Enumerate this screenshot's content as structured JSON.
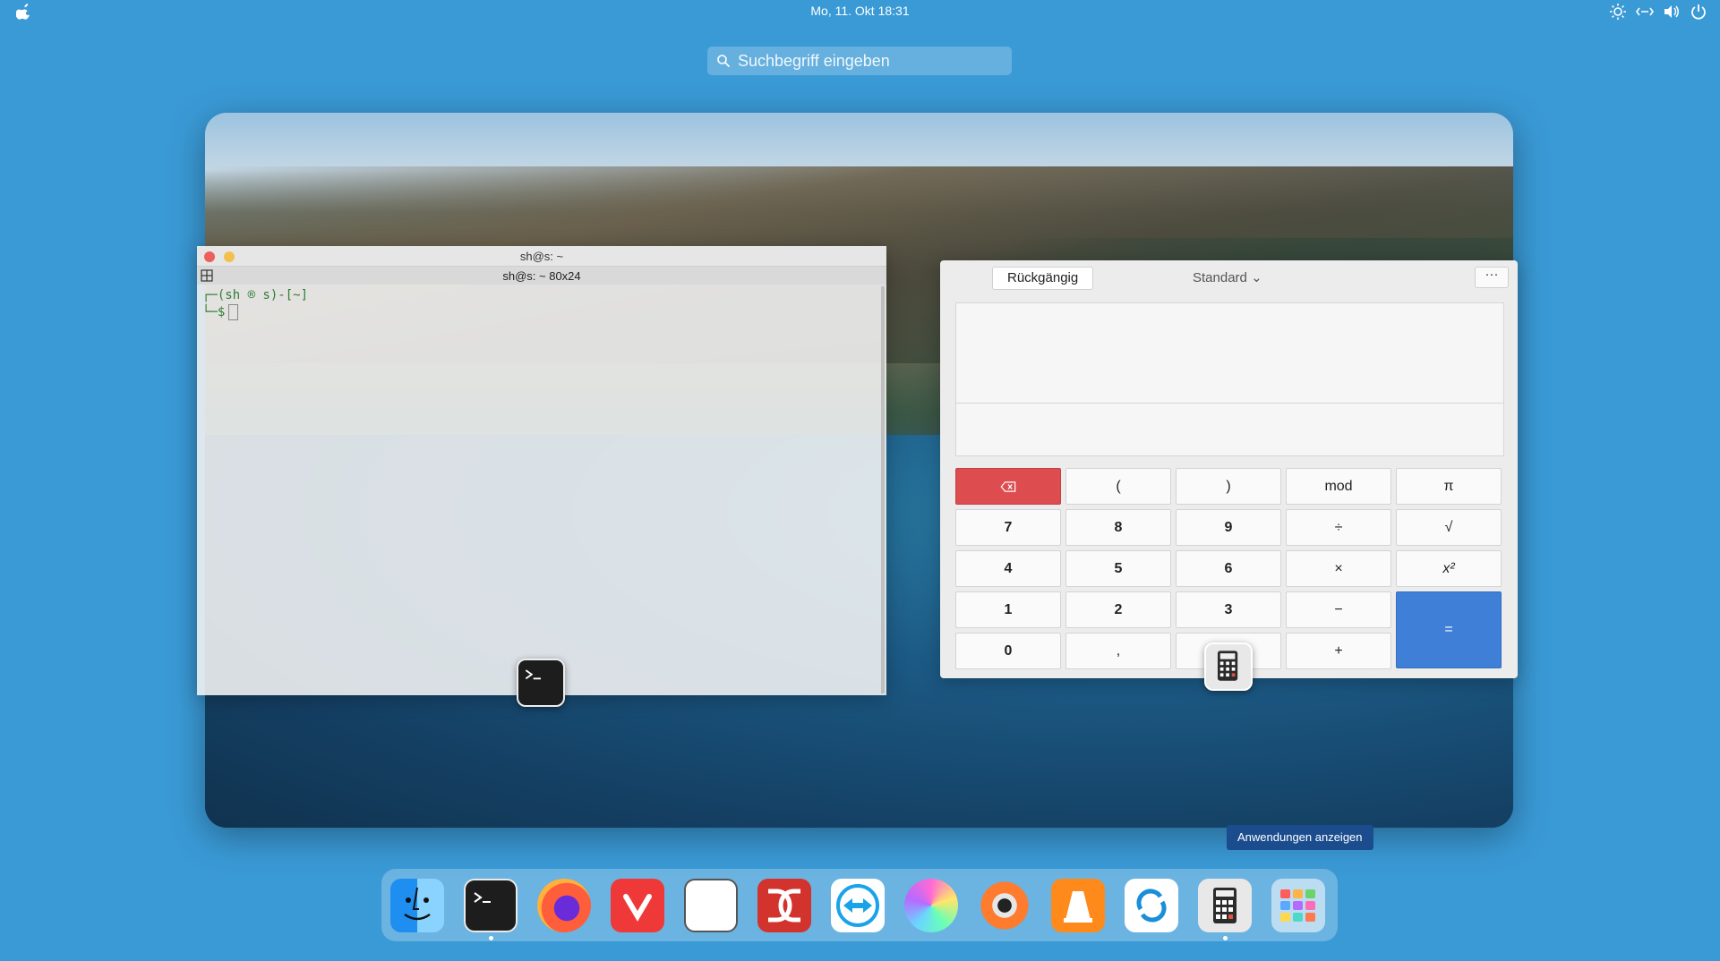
{
  "topbar": {
    "datetime": "Mo, 11. Okt 18:31",
    "tray_icons": [
      "brightness-icon",
      "network-icon",
      "volume-icon",
      "power-icon"
    ]
  },
  "search": {
    "placeholder": "Suchbegriff eingeben"
  },
  "terminal": {
    "title": "sh@s: ~",
    "tab_title": "sh@s: ~ 80x24",
    "prompt_line1": "┌─(sh ® s)-[~]",
    "prompt_line2": "└─$"
  },
  "calculator": {
    "undo_label": "Rückgängig",
    "mode_label": "Standard",
    "menu_label": "···",
    "keys": [
      [
        "⌫",
        "(",
        ")",
        "mod",
        "π"
      ],
      [
        "7",
        "8",
        "9",
        "÷",
        "√"
      ],
      [
        "4",
        "5",
        "6",
        "×",
        "x²"
      ],
      [
        "1",
        "2",
        "3",
        "−",
        "="
      ],
      [
        "0",
        ",",
        "",
        "+",
        ""
      ]
    ]
  },
  "tooltip": "Anwendungen anzeigen",
  "dock": {
    "items": [
      {
        "name": "finder-icon",
        "active": false
      },
      {
        "name": "terminal-icon",
        "active": true
      },
      {
        "name": "firefox-icon",
        "active": false
      },
      {
        "name": "vivaldi-icon",
        "active": false
      },
      {
        "name": "text-editor-icon",
        "active": false
      },
      {
        "name": "double-commander-icon",
        "active": false
      },
      {
        "name": "teamviewer-icon",
        "active": false
      },
      {
        "name": "color-picker-icon",
        "active": false
      },
      {
        "name": "xnview-icon",
        "active": false
      },
      {
        "name": "vlc-icon",
        "active": false
      },
      {
        "name": "sync-icon",
        "active": false
      },
      {
        "name": "calculator-icon",
        "active": true
      },
      {
        "name": "app-launcher-icon",
        "active": false
      }
    ]
  },
  "colors": {
    "desktop": "#3a9ad6",
    "calc_delete": "#dd4c4f",
    "calc_equals": "#3f7fd7",
    "tooltip": "#1b4d8e"
  }
}
